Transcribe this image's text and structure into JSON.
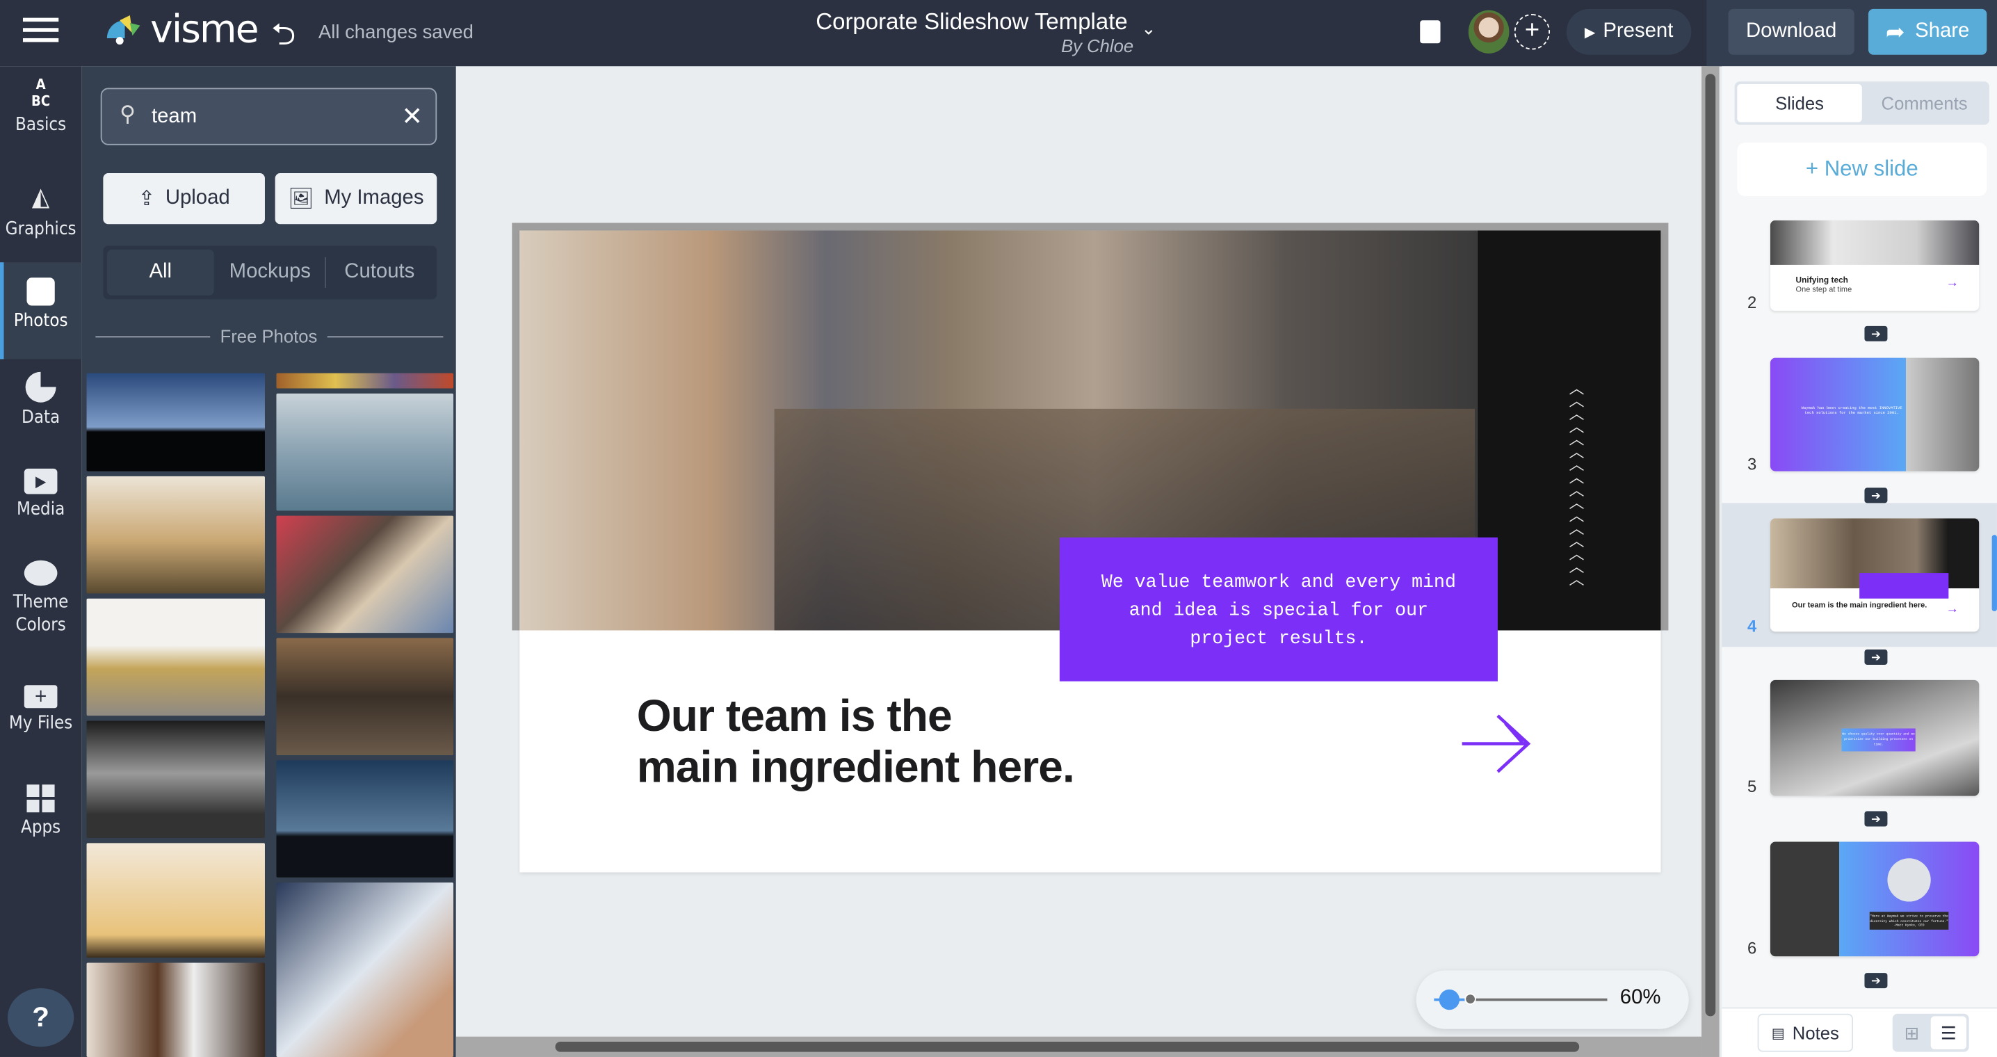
{
  "app": {
    "logo": "visme",
    "save_status": "All changes saved",
    "title": "Corporate Slideshow Template",
    "author": "By Chloe"
  },
  "toolbar": {
    "present": "Present",
    "download": "Download",
    "share": "Share"
  },
  "rail": {
    "items": [
      {
        "label": "Basics",
        "icon": "abc-blocks-icon"
      },
      {
        "label": "Graphics",
        "icon": "shapes-icon"
      },
      {
        "label": "Photos",
        "icon": "photo-icon",
        "active": true
      },
      {
        "label": "Data",
        "icon": "pie-chart-icon"
      },
      {
        "label": "Media",
        "icon": "video-icon"
      },
      {
        "label": "Theme",
        "label2": "Colors",
        "icon": "palette-icon"
      },
      {
        "label": "My Files",
        "icon": "folder-icon"
      },
      {
        "label": "Apps",
        "icon": "apps-icon"
      }
    ],
    "help": "?"
  },
  "panel": {
    "search_value": "team",
    "upload": "Upload",
    "my_images": "My Images",
    "filters": [
      "All",
      "Mockups",
      "Cutouts"
    ],
    "active_filter": "All",
    "section": "Free Photos"
  },
  "slide": {
    "callout": "We value teamwork and every mind and idea is special for our project results.",
    "heading_line1": "Our team is the",
    "heading_line2": "main ingredient here.",
    "accent": "#7b2ff7"
  },
  "zoom": {
    "level": "60%",
    "value": 60
  },
  "right": {
    "tabs": [
      "Slides",
      "Comments"
    ],
    "active_tab": "Slides",
    "new_slide": "+ New slide",
    "accent": "#5aacd8",
    "slides": [
      {
        "num": "2",
        "title": "Unifying tech",
        "subtitle": "One step at time"
      },
      {
        "num": "3",
        "text": "Waymak has been creating the most INNOVATIVE tech solutions for the market since 2001."
      },
      {
        "num": "4",
        "title": "Our team is the main ingredient here.",
        "active": true
      },
      {
        "num": "5",
        "text": "We choose quality over quantity and we prioritize our building processes on time."
      },
      {
        "num": "6",
        "text": "\"Here at Waymak we strive to preserve the diversity which constitutes our fortune.\" -Matt Kyoko, CEO"
      }
    ],
    "notes": "Notes"
  }
}
